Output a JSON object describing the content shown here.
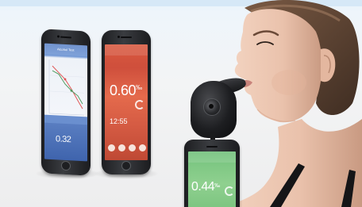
{
  "phones": {
    "left": {
      "reading": "0.32",
      "header": "Alcohol Test"
    },
    "middle": {
      "reading": "0.60",
      "unit": "‰",
      "time": "12:55"
    },
    "front": {
      "reading": "0.44",
      "unit": "‰"
    }
  },
  "colors": {
    "blue_app": "#5f86c9",
    "red_app": "#d55b43",
    "green_app": "#7fc884",
    "device": "#1d1e21"
  }
}
